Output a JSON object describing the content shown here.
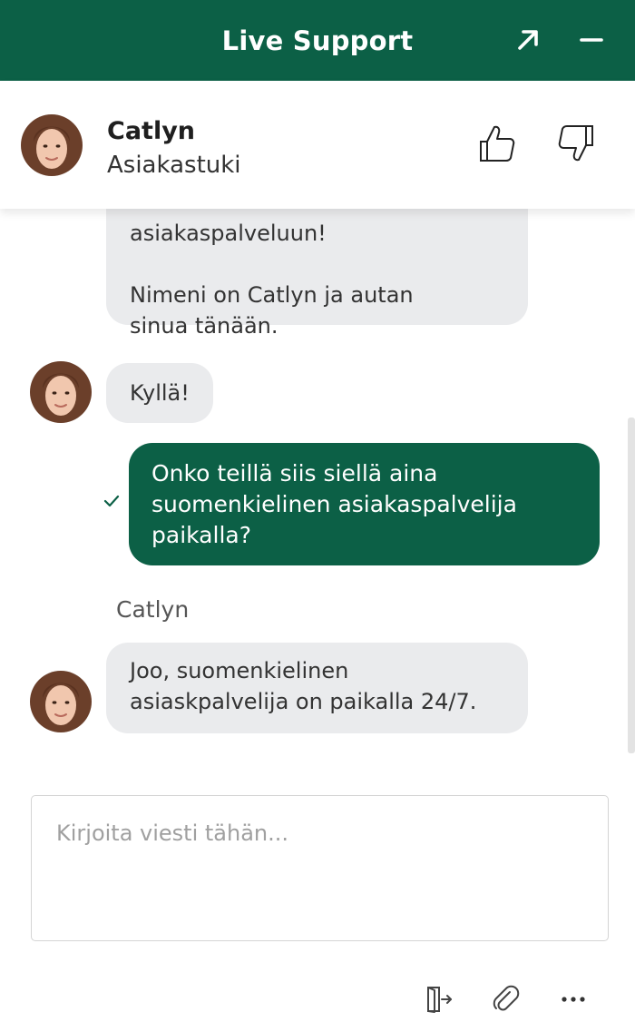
{
  "colors": {
    "brand": "#0c6046",
    "bubble_bg": "#eaebed"
  },
  "header": {
    "title": "Live Support",
    "popout_icon": "arrow-up-right-icon",
    "minimize_icon": "minus-icon"
  },
  "agent": {
    "name": "Catlyn",
    "role": "Asiakastuki",
    "rate_up_icon": "thumbs-up-icon",
    "rate_down_icon": "thumbs-down-icon"
  },
  "messages": [
    {
      "from": "agent",
      "lines": [
        "asiakaspalveluun!",
        "",
        "Nimeni on Catlyn ja autan",
        "sinua tänään."
      ]
    },
    {
      "from": "agent",
      "text": "Kyllä!"
    },
    {
      "from": "user",
      "lines": [
        "Onko teillä siis siellä aina",
        "suomenkielinen asiakaspalvelija",
        "paikalla?"
      ],
      "status_icon": "check-icon"
    },
    {
      "from": "agent",
      "sender_label": "Catlyn",
      "lines": [
        "Joo, suomenkielinen",
        "asiaskpalvelija on paikalla 24/7."
      ]
    }
  ],
  "composer": {
    "placeholder": "Kirjoita viesti tähän..."
  },
  "toolbar": {
    "end_chat_icon": "exit-door-icon",
    "attach_icon": "paperclip-icon",
    "more_icon": "more-dots-icon"
  }
}
